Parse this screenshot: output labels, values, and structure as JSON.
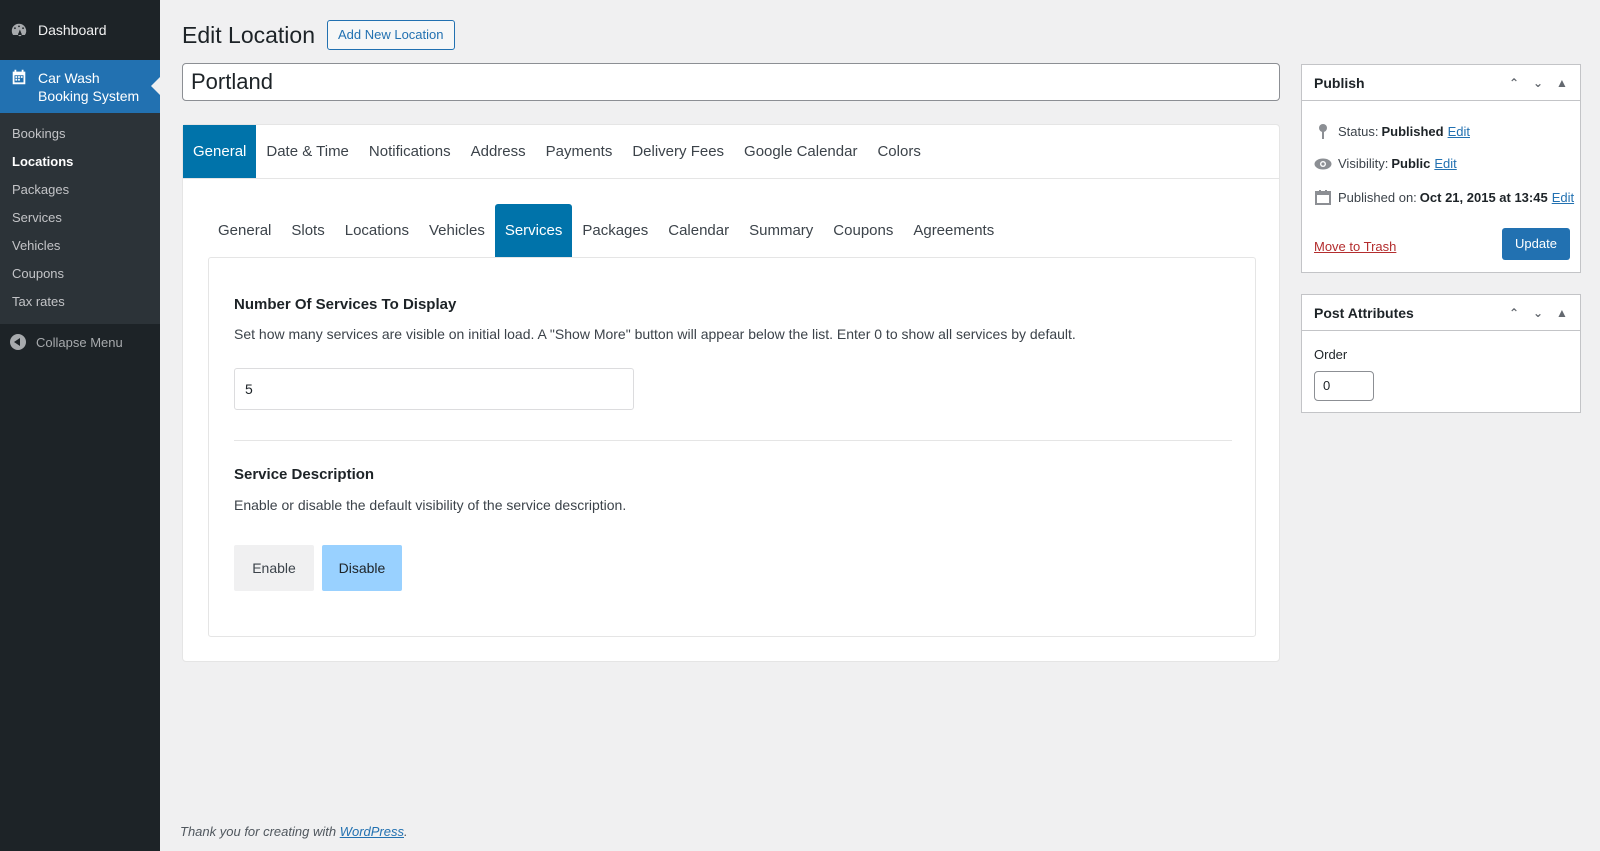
{
  "sidebar": {
    "dashboard_label": "Dashboard",
    "dashboard_icon": "dashboard-gauge-icon",
    "plugin_label": "Car Wash Booking System",
    "plugin_icon": "calendar-icon",
    "submenu": [
      "Bookings",
      "Locations",
      "Packages",
      "Services",
      "Vehicles",
      "Coupons",
      "Tax rates"
    ],
    "current_submenu": "Locations",
    "collapse_label": "Collapse Menu",
    "active_color": "#2271b1"
  },
  "header": {
    "title": "Edit Location",
    "add_new_label": "Add New Location"
  },
  "post_title": "Portland",
  "main_tabs": [
    "General",
    "Date & Time",
    "Notifications",
    "Address",
    "Payments",
    "Delivery Fees",
    "Google Calendar",
    "Colors"
  ],
  "main_tab_active": "General",
  "sub_tabs": [
    "General",
    "Slots",
    "Locations",
    "Vehicles",
    "Services",
    "Packages",
    "Calendar",
    "Summary",
    "Coupons",
    "Agreements"
  ],
  "sub_tab_active": "Services",
  "services_display": {
    "title": "Number Of Services To Display",
    "description": "Set how many services are visible on initial load. A \"Show More\" button will appear below the list. Enter 0 to show all services by default.",
    "value": "5"
  },
  "service_description": {
    "title": "Service Description",
    "description": "Enable or disable the default visibility of the service description.",
    "enable_label": "Enable",
    "disable_label": "Disable",
    "selected": "Disable"
  },
  "publish": {
    "title": "Publish",
    "status_label": "Status:",
    "status_value": "Published",
    "visibility_label": "Visibility:",
    "visibility_value": "Public",
    "published_label": "Published on:",
    "published_value": "Oct 21, 2015 at 13:45",
    "edit_label": "Edit",
    "trash_label": "Move to Trash",
    "update_label": "Update"
  },
  "attributes": {
    "title": "Post Attributes",
    "order_label": "Order",
    "order_value": "0"
  },
  "footer": {
    "text": "Thank you for creating with ",
    "link": "WordPress",
    "suffix": "."
  }
}
